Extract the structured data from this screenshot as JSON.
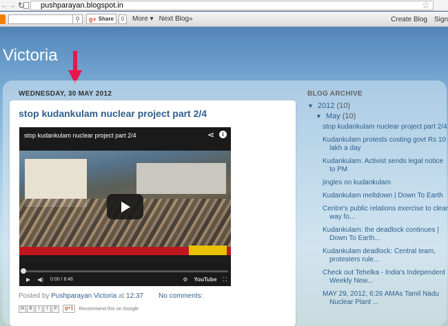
{
  "browser": {
    "url_domain": "pushparayan.blogspot.in",
    "back_icon": "arrow-left-icon",
    "forward_icon": "arrow-right-icon",
    "reload_icon": "reload-icon",
    "bookmark_icon": "star-icon"
  },
  "navbar": {
    "share_label": "Share",
    "share_count": "0",
    "more_label": "More",
    "next_blog_label": "Next Blog»",
    "create_blog_label": "Create Blog",
    "sign_in_label": "Sign"
  },
  "blog": {
    "title": "Victoria"
  },
  "post": {
    "date": "WEDNESDAY, 30 MAY 2012",
    "title": "stop kudankulam nuclear project part 2/4",
    "video": {
      "title": "stop kudankulam nuclear project part 2/4",
      "time": "0:00 / 8:46",
      "brand": "YouTube",
      "progress": 0
    },
    "footer": {
      "posted_by": "Posted by",
      "author": "Pushparayan Victoria",
      "at": "at",
      "time": "12:37",
      "comments": "No comments:"
    },
    "share": {
      "gplus_label": "g+1",
      "recommend": "Recommend this on Google"
    }
  },
  "sidebar": {
    "heading": "BLOG ARCHIVE",
    "year": "2012",
    "year_count": "(10)",
    "month": "May",
    "month_count": "(10)",
    "posts": [
      "stop kudankulam nuclear project part 2/4",
      "Kudankulam protests costing govt Rs 10 lakh a day",
      "Kudankulam: Activist sends legal notice to PM",
      "jingles on kudankulam",
      "Kudankulam meltdown | Down To Earth",
      "Centre's public relations exercise to clear way fo...",
      "Kudankulam: the deadlock continues | Down To Earth...",
      "Kudankulam deadlock: Central team, protesters rule...",
      "Check out Tehelka - India's Independent Weekly New...",
      "MAY 29, 2012, 6:26 AMAs Tamil Nadu Nuclear Plant ..."
    ]
  },
  "colors": {
    "link": "#2f5f8c",
    "arrow": "#e8174a"
  }
}
